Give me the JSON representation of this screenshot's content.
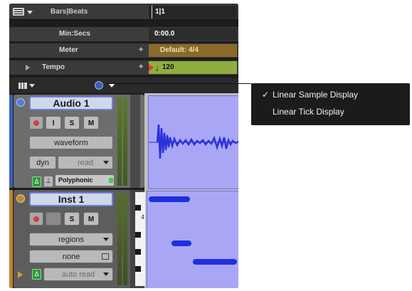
{
  "ruler": {
    "rows": [
      {
        "name": "Bars|Beats",
        "value": "1|1"
      },
      {
        "name": "Min:Secs",
        "value": "0:00.0"
      },
      {
        "name": "Meter",
        "value": "Default: 4/4"
      },
      {
        "name": "Tempo",
        "value": "120"
      }
    ],
    "plus_glyph": "+"
  },
  "tracks": [
    {
      "name": "Audio 1",
      "buttons": {
        "input": "I",
        "solo": "S",
        "mute": "M"
      },
      "view_selector": "waveform",
      "automation_label": "dyn",
      "automation_mode": "read",
      "plugin_name": "Polyphonic"
    },
    {
      "name": "Inst 1",
      "buttons": {
        "solo": "S",
        "mute": "M"
      },
      "view_selector": "regions",
      "automation_label": "none",
      "automation_mode": "auto read",
      "keyboard_octave": "4"
    }
  ],
  "popup_menu": {
    "items": [
      {
        "label": "Linear Sample Display",
        "checked": true
      },
      {
        "label": "Linear Tick Display",
        "checked": false
      }
    ],
    "check_glyph": "✓"
  },
  "colors": {
    "clip_bg": "#a9a6f6",
    "waveform": "#2b32d8",
    "midi_note": "#1e2fe0",
    "meter_lane": "#8a6a2a",
    "tempo_lane": "#8fae3f",
    "audio_track": "#6d6d6d",
    "inst_track": "#5d5d5d",
    "track_name_border": "#6f7fd6"
  }
}
